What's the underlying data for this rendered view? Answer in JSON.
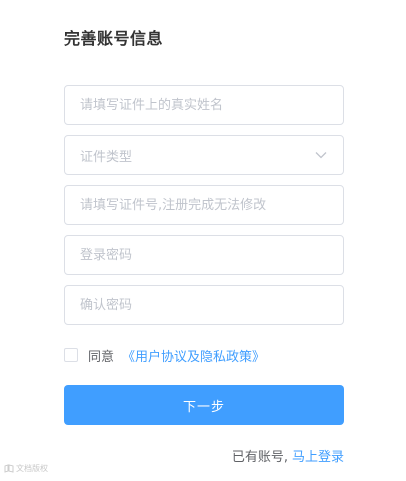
{
  "page": {
    "title": "完善账号信息"
  },
  "form": {
    "real_name_placeholder": "请填写证件上的真实姓名",
    "id_type_placeholder": "证件类型",
    "id_number_placeholder": "请填写证件号,注册完成无法修改",
    "password_placeholder": "登录密码",
    "confirm_password_placeholder": "确认密码"
  },
  "agreement": {
    "checked": false,
    "label": "同意",
    "link_text": "《用户协议及隐私政策》"
  },
  "actions": {
    "next_label": "下一步"
  },
  "footer": {
    "has_account_text": "已有账号,",
    "login_link": "马上登录"
  },
  "watermark": {
    "text": "文档版权"
  },
  "colors": {
    "primary": "#409eff",
    "border": "#dcdfe6",
    "placeholder": "#c0c4cc",
    "text": "#606266",
    "title": "#333333"
  },
  "icons": {
    "select_caret": "chevron-down-icon",
    "watermark_logo": "logo-icon"
  }
}
